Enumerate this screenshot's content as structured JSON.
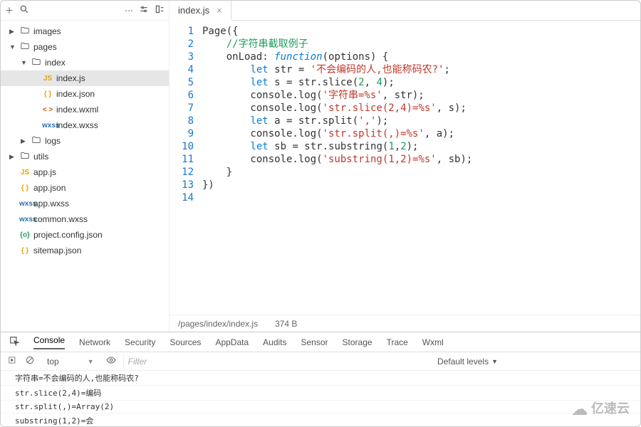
{
  "toolbar_icons": [
    "+",
    "search",
    "…",
    "settings",
    "indent"
  ],
  "tree": [
    {
      "depth": 0,
      "arrow": "▶",
      "kind": "folder",
      "label": "images"
    },
    {
      "depth": 0,
      "arrow": "▼",
      "kind": "folder",
      "label": "pages"
    },
    {
      "depth": 1,
      "arrow": "▼",
      "kind": "folder",
      "label": "index"
    },
    {
      "depth": 2,
      "arrow": "",
      "kind": "js",
      "fic": "JS",
      "label": "index.js",
      "selected": true
    },
    {
      "depth": 2,
      "arrow": "",
      "kind": "jn",
      "fic": "{ }",
      "label": "index.json"
    },
    {
      "depth": 2,
      "arrow": "",
      "kind": "ml",
      "fic": "< >",
      "label": "index.wxml"
    },
    {
      "depth": 2,
      "arrow": "",
      "kind": "xs",
      "fic": "wxss",
      "label": "index.wxss"
    },
    {
      "depth": 1,
      "arrow": "▶",
      "kind": "folder",
      "label": "logs"
    },
    {
      "depth": 0,
      "arrow": "▶",
      "kind": "folder",
      "label": "utils"
    },
    {
      "depth": 0,
      "arrow": "",
      "kind": "js",
      "fic": "JS",
      "label": "app.js"
    },
    {
      "depth": 0,
      "arrow": "",
      "kind": "jn",
      "fic": "{ }",
      "label": "app.json"
    },
    {
      "depth": 0,
      "arrow": "",
      "kind": "xs",
      "fic": "wxss",
      "label": "app.wxss"
    },
    {
      "depth": 0,
      "arrow": "",
      "kind": "xs",
      "fic": "wxss",
      "label": "common.wxss"
    },
    {
      "depth": 0,
      "arrow": "",
      "kind": "pj",
      "fic": "{o}",
      "label": "project.config.json"
    },
    {
      "depth": 0,
      "arrow": "",
      "kind": "jn",
      "fic": "{ }",
      "label": "sitemap.json"
    }
  ],
  "tab": {
    "label": "index.js"
  },
  "gutter": [
    "1",
    "2",
    "3",
    "4",
    "5",
    "6",
    "7",
    "8",
    "9",
    "10",
    "11",
    "12",
    "13",
    "14"
  ],
  "code_tokens": [
    [
      [
        "",
        "Page({"
      ]
    ],
    [
      [
        "",
        "    "
      ],
      [
        "cm",
        "//字符串截取例子"
      ]
    ],
    [
      [
        "",
        "    onLoad: "
      ],
      [
        "fn",
        "function"
      ],
      [
        "",
        "(options) {"
      ]
    ],
    [
      [
        "",
        "        "
      ],
      [
        "kw",
        "let"
      ],
      [
        "",
        " str = "
      ],
      [
        "st",
        "'不会编码的人,也能称码农?'"
      ],
      [
        "",
        ";"
      ]
    ],
    [
      [
        "",
        "        "
      ],
      [
        "kw",
        "let"
      ],
      [
        "",
        " s = str.slice("
      ],
      [
        "nm",
        "2"
      ],
      [
        "",
        ", "
      ],
      [
        "nm",
        "4"
      ],
      [
        "",
        ");"
      ]
    ],
    [
      [
        "",
        "        console.log("
      ],
      [
        "st",
        "'字符串=%s'"
      ],
      [
        "",
        ", str);"
      ]
    ],
    [
      [
        "",
        "        console.log("
      ],
      [
        "st",
        "'str.slice(2,4)=%s'"
      ],
      [
        "",
        ", s);"
      ]
    ],
    [
      [
        "",
        "        "
      ],
      [
        "kw",
        "let"
      ],
      [
        "",
        " a = str.split("
      ],
      [
        "st",
        "','"
      ],
      [
        "",
        ");"
      ]
    ],
    [
      [
        "",
        "        console.log("
      ],
      [
        "st",
        "'str.split(,)=%s'"
      ],
      [
        "",
        ", a);"
      ]
    ],
    [
      [
        "",
        "        "
      ],
      [
        "kw",
        "let"
      ],
      [
        "",
        " sb = str.substring("
      ],
      [
        "nm",
        "1"
      ],
      [
        "",
        ","
      ],
      [
        "nm",
        "2"
      ],
      [
        "",
        ");"
      ]
    ],
    [
      [
        "",
        "        console.log("
      ],
      [
        "st",
        "'substring(1,2)=%s'"
      ],
      [
        "",
        ", sb);"
      ]
    ],
    [
      [
        "",
        "    }"
      ]
    ],
    [
      [
        "",
        "})"
      ]
    ],
    [
      [
        "",
        ""
      ]
    ]
  ],
  "status": {
    "path": "/pages/index/index.js",
    "size": "374 B"
  },
  "devtools": {
    "tabs": [
      "Console",
      "Network",
      "Security",
      "Sources",
      "AppData",
      "Audits",
      "Sensor",
      "Storage",
      "Trace",
      "Wxml"
    ],
    "context": "top",
    "filter_placeholder": "Filter",
    "levels": "Default levels",
    "logs": [
      "字符串=不会编码的人,也能称码农?",
      "str.slice(2,4)=编码",
      "str.split(,)=Array(2)",
      "substring(1,2)=会"
    ]
  },
  "watermark": "亿速云"
}
